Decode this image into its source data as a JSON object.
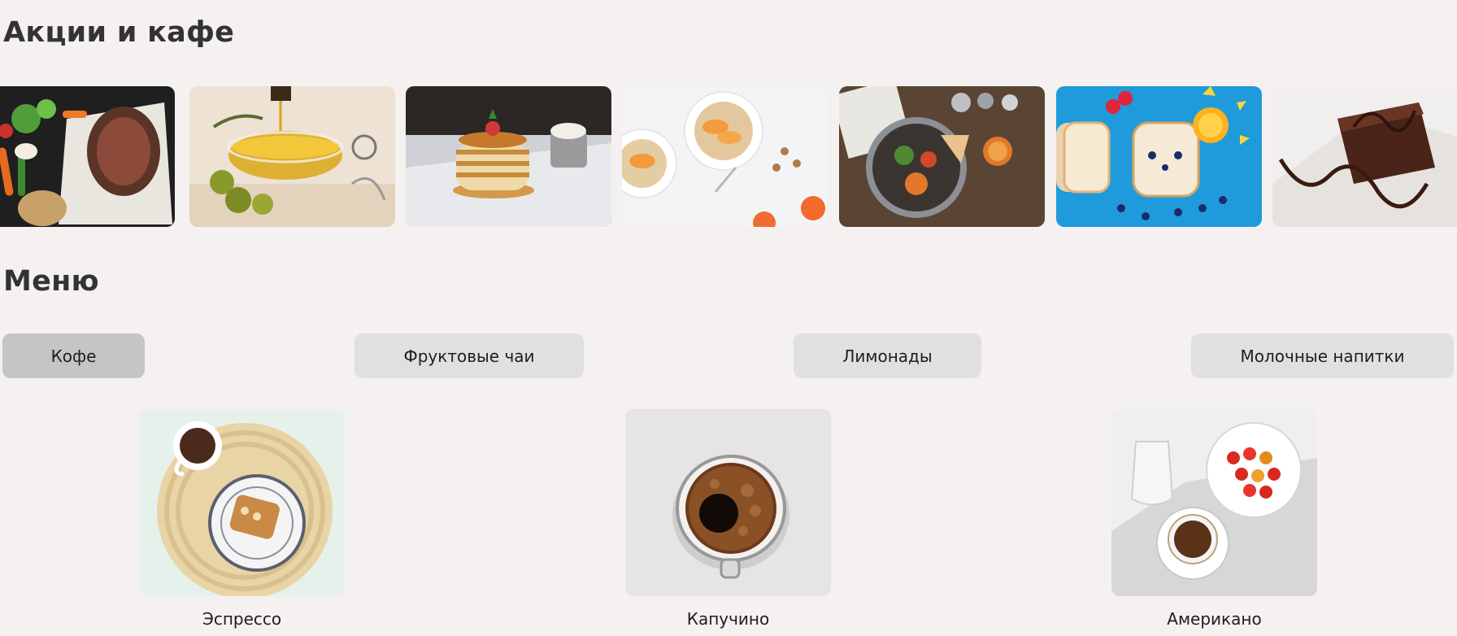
{
  "promo": {
    "title": "Акции и кафе",
    "items": [
      {
        "icon": "steak-vegetables-photo"
      },
      {
        "icon": "olive-oil-photo"
      },
      {
        "icon": "pancakes-photo"
      },
      {
        "icon": "oatmeal-bowls-photo"
      },
      {
        "icon": "breakfast-table-photo"
      },
      {
        "icon": "toast-face-photo"
      },
      {
        "icon": "chocolate-brownie-photo"
      }
    ]
  },
  "menu": {
    "title": "Меню",
    "tabs": [
      {
        "label": "Кофе",
        "active": true
      },
      {
        "label": "Фруктовые чаи",
        "active": false
      },
      {
        "label": "Лимонады",
        "active": false
      },
      {
        "label": "Молочные напитки",
        "active": false
      }
    ],
    "products": [
      {
        "name": "Эспрессо",
        "icon": "espresso-photo"
      },
      {
        "name": "Капучино",
        "icon": "cappuccino-photo"
      },
      {
        "name": "Американо",
        "icon": "americano-photo"
      }
    ]
  },
  "colors": {
    "background": "#f4f1f0",
    "tab": "#e1e0e0",
    "tab_active": "#c6c5c5",
    "heading": "#333333"
  }
}
